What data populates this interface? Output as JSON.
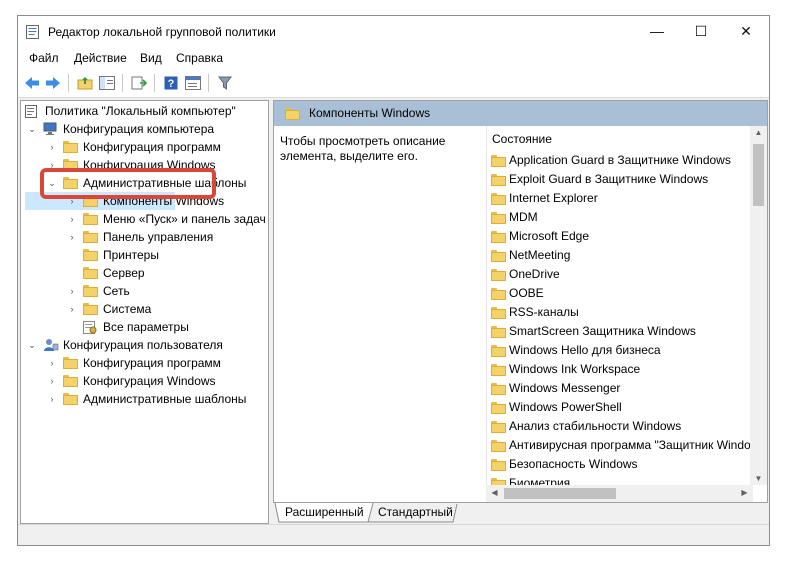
{
  "window": {
    "title": "Редактор локальной групповой политики",
    "controls": {
      "minimize": "—",
      "maximize": "☐",
      "close": "✕"
    }
  },
  "menu": [
    "Файл",
    "Действие",
    "Вид",
    "Справка"
  ],
  "toolbar": {
    "icons": [
      "back-arrow-icon",
      "forward-arrow-icon",
      "up-folder-icon",
      "show-hide-tree-icon",
      "export-list-icon",
      "help-icon",
      "properties-icon",
      "filter-icon"
    ]
  },
  "tree": {
    "root": "Политика \"Локальный компьютер\"",
    "computer": "Конфигурация компьютера",
    "computer_children": [
      "Конфигурация программ",
      "Конфигурация Windows",
      "Административные шаблоны"
    ],
    "admin_children": [
      "Компоненты Windows",
      "Меню «Пуск» и панель задач",
      "Панель управления",
      "Принтеры",
      "Сервер",
      "Сеть",
      "Система",
      "Все параметры"
    ],
    "user": "Конфигурация пользователя",
    "user_children": [
      "Конфигурация программ",
      "Конфигурация Windows",
      "Административные шаблоны"
    ]
  },
  "right_pane": {
    "header": "Компоненты Windows",
    "description": "Чтобы просмотреть описание элемента, выделите его.",
    "column": "Состояние",
    "items": [
      "Application Guard в Защитнике Windows",
      "Exploit Guard в Защитнике Windows",
      "Internet Explorer",
      "MDM",
      "Microsoft Edge",
      "NetMeeting",
      "OneDrive",
      "OOBE",
      "RSS-каналы",
      "SmartScreen Защитника Windows",
      "Windows Hello для бизнеса",
      "Windows Ink Workspace",
      "Windows Messenger",
      "Windows PowerShell",
      "Анализ стабильности Windows",
      "Антивирусная программа \"Защитник Windo",
      "Безопасность Windows",
      "Биометрия"
    ]
  },
  "tabs": {
    "extended": "Расширенный",
    "standard": "Стандартный"
  },
  "colors": {
    "header_bg": "#a9bfd6",
    "highlight_border": "#d9473b",
    "folder": "#f5d169",
    "selection": "#cce8ff"
  }
}
